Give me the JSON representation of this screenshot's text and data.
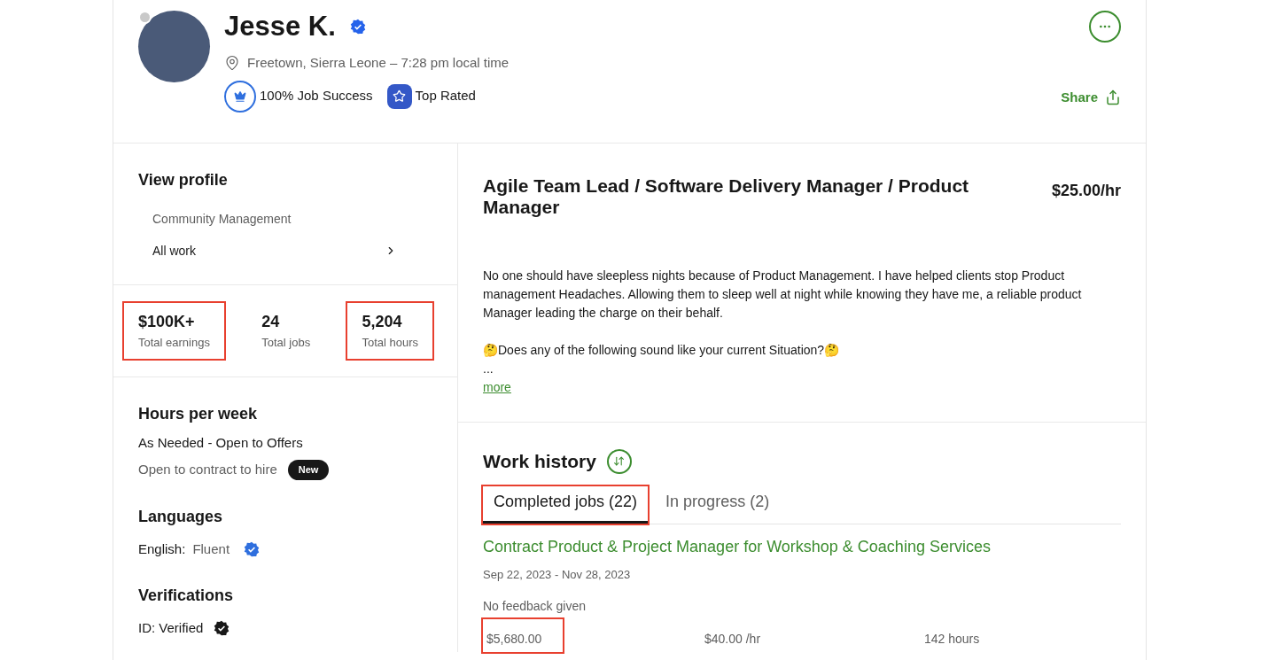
{
  "profile": {
    "name": "Jesse K.",
    "verified": true,
    "online": false,
    "location": "Freetown, Sierra Leone – 7:28 pm local time",
    "badges": [
      {
        "kind": "success",
        "label": "100% Job Success"
      },
      {
        "kind": "rated",
        "label": "Top Rated"
      }
    ],
    "share": "Share"
  },
  "sidebar": {
    "view_profile": {
      "title": "View profile",
      "items": [
        {
          "label": "Community Management",
          "selected": false,
          "chevron": false
        },
        {
          "label": "All work",
          "selected": true,
          "chevron": true
        }
      ]
    },
    "stats": [
      {
        "value": "$100K+",
        "label": "Total earnings",
        "highlighted": true
      },
      {
        "value": "24",
        "label": "Total jobs",
        "highlighted": false
      },
      {
        "value": "5,204",
        "label": "Total hours",
        "highlighted": true
      }
    ],
    "hours": {
      "title": "Hours per week",
      "value": "As Needed - Open to Offers",
      "contract": "Open to contract to hire",
      "badge": "New"
    },
    "languages": {
      "title": "Languages",
      "items": [
        {
          "name": "English:",
          "level": "Fluent",
          "verified": true
        }
      ]
    },
    "verifications": {
      "title": "Verifications",
      "items": [
        {
          "label": "ID: Verified",
          "verified": true
        }
      ]
    }
  },
  "main": {
    "title": "Agile Team Lead / Software Delivery Manager / Product Manager",
    "rate": "$25.00/hr",
    "description": [
      "No one should have sleepless nights because of Product Management. I have helped clients stop Product management Headaches. Allowing them to sleep well at night while knowing they have me, a reliable product Manager leading the charge on their behalf.",
      "🤔Does any of the following sound like your current Situation?🤔",
      "..."
    ],
    "more": "more"
  },
  "work_history": {
    "title": "Work history",
    "tabs": [
      {
        "label": "Completed jobs (22)",
        "selected": true,
        "highlighted": true
      },
      {
        "label": "In progress (2)",
        "selected": false,
        "highlighted": false
      }
    ],
    "jobs": [
      {
        "title": "Contract Product & Project Manager for Workshop & Coaching Services",
        "dates": "Sep 22, 2023 - Nov 28, 2023",
        "feedback": "No feedback given",
        "amount": "$5,680.00",
        "amount_highlighted": true,
        "rate": "$40.00 /hr",
        "hours": "142 hours"
      }
    ]
  }
}
